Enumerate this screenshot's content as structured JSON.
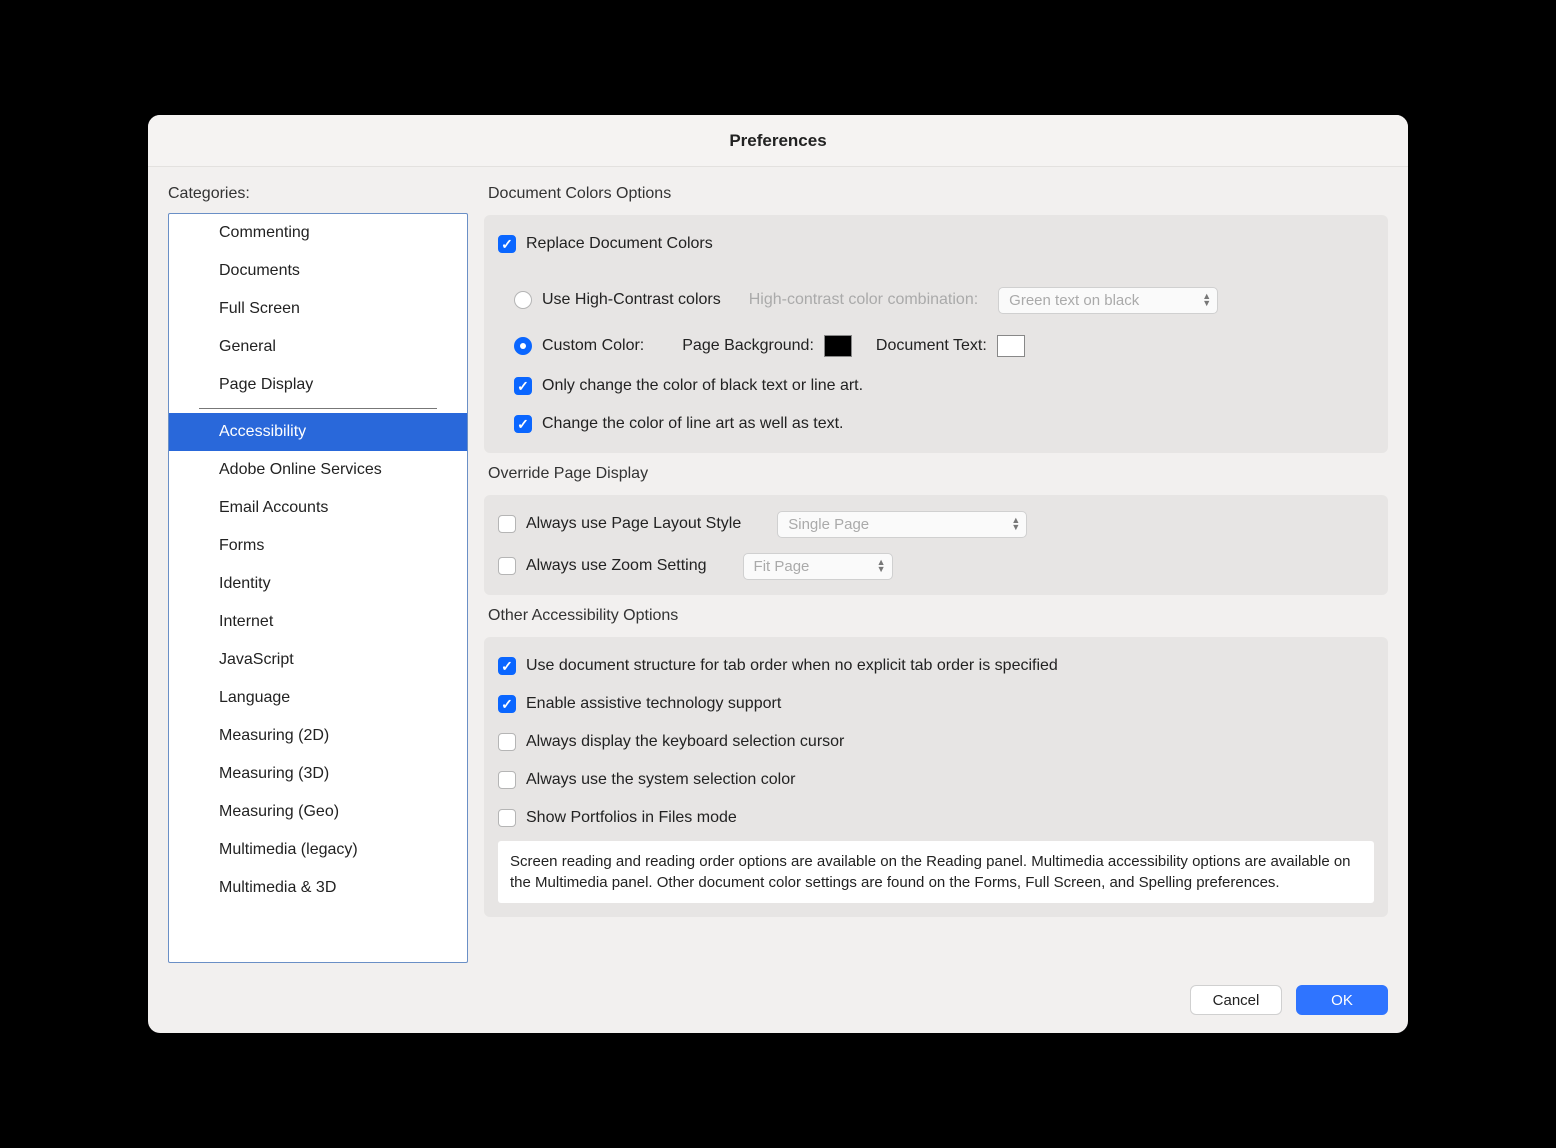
{
  "window_title": "Preferences",
  "sidebar": {
    "title": "Categories:",
    "group1": [
      {
        "label": "Commenting"
      },
      {
        "label": "Documents"
      },
      {
        "label": "Full Screen"
      },
      {
        "label": "General"
      },
      {
        "label": "Page Display"
      }
    ],
    "group2": [
      {
        "label": "Accessibility",
        "selected": true
      },
      {
        "label": "Adobe Online Services"
      },
      {
        "label": "Email Accounts"
      },
      {
        "label": "Forms"
      },
      {
        "label": "Identity"
      },
      {
        "label": "Internet"
      },
      {
        "label": "JavaScript"
      },
      {
        "label": "Language"
      },
      {
        "label": "Measuring (2D)"
      },
      {
        "label": "Measuring (3D)"
      },
      {
        "label": "Measuring (Geo)"
      },
      {
        "label": "Multimedia (legacy)"
      },
      {
        "label": "Multimedia & 3D"
      }
    ]
  },
  "sections": {
    "doc_colors": {
      "title": "Document Colors Options",
      "replace": "Replace Document Colors",
      "use_high_contrast": "Use High-Contrast colors",
      "hc_combo_label": "High-contrast color combination:",
      "hc_combo_value": "Green text on black",
      "custom_color": "Custom Color:",
      "page_bg": "Page Background:",
      "doc_text": "Document Text:",
      "page_bg_color": "#000000",
      "doc_text_color": "#ffffff",
      "only_black": "Only change the color of black text or line art.",
      "line_art": "Change the color of line art as well as text."
    },
    "override": {
      "title": "Override Page Display",
      "page_layout": "Always use Page Layout Style",
      "page_layout_value": "Single Page",
      "zoom": "Always use Zoom Setting",
      "zoom_value": "Fit Page"
    },
    "other": {
      "title": "Other Accessibility Options",
      "tab_order": "Use document structure for tab order when no explicit tab order is specified",
      "assistive": "Enable assistive technology support",
      "keyboard_cursor": "Always display the keyboard selection cursor",
      "system_color": "Always use the system selection color",
      "portfolios": "Show Portfolios in Files mode",
      "info": "Screen reading and reading order options are available on the Reading panel. Multimedia accessibility options are available on the Multimedia panel. Other document color settings are found on the Forms, Full Screen, and Spelling preferences."
    }
  },
  "buttons": {
    "cancel": "Cancel",
    "ok": "OK"
  }
}
